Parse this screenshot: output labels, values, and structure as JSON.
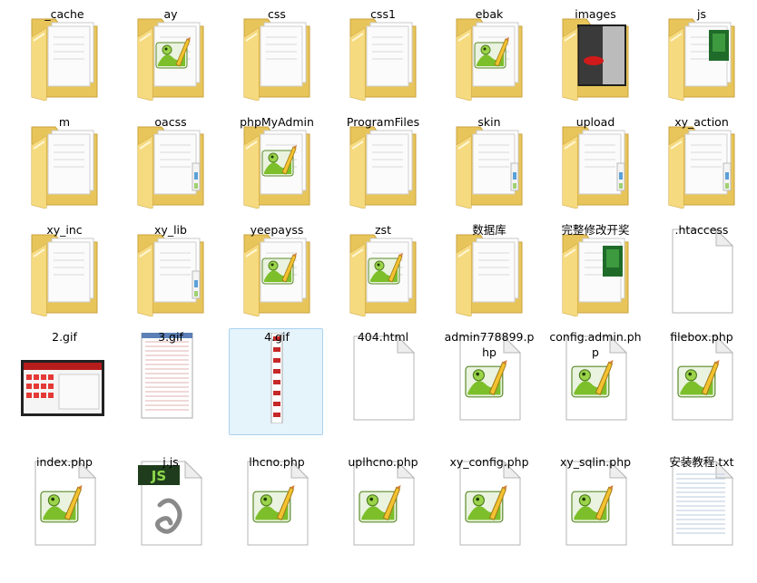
{
  "view": "file-explorer-large-icons",
  "items": [
    {
      "label": "_cache",
      "kind": "folder",
      "content": "docs"
    },
    {
      "label": "ay",
      "kind": "folder",
      "content": "notepad"
    },
    {
      "label": "css",
      "kind": "folder",
      "content": "docs"
    },
    {
      "label": "css1",
      "kind": "folder",
      "content": "docs"
    },
    {
      "label": "ebak",
      "kind": "folder",
      "content": "notepad"
    },
    {
      "label": "images",
      "kind": "folder",
      "content": "photo"
    },
    {
      "label": "js",
      "kind": "folder",
      "content": "green"
    },
    {
      "label": "m",
      "kind": "folder",
      "content": "docs"
    },
    {
      "label": "oacss",
      "kind": "folder",
      "content": "tabs"
    },
    {
      "label": "phpMyAdmin",
      "kind": "folder",
      "content": "notepad"
    },
    {
      "label": "ProgramFiles",
      "kind": "folder",
      "content": "docs"
    },
    {
      "label": "skin",
      "kind": "folder",
      "content": "tabs"
    },
    {
      "label": "upload",
      "kind": "folder",
      "content": "tabs"
    },
    {
      "label": "xy_action",
      "kind": "folder",
      "content": "tabs"
    },
    {
      "label": "xy_inc",
      "kind": "folder",
      "content": "docs"
    },
    {
      "label": "xy_lib",
      "kind": "folder",
      "content": "tabs"
    },
    {
      "label": "yeepayss",
      "kind": "folder",
      "content": "notepad"
    },
    {
      "label": "zst",
      "kind": "folder",
      "content": "notepad"
    },
    {
      "label": "数据库",
      "kind": "folder",
      "content": "blank"
    },
    {
      "label": "完整修改开奖",
      "kind": "folder",
      "content": "green"
    },
    {
      "label": ".htaccess",
      "kind": "file",
      "content": "blank"
    },
    {
      "label": "2.gif",
      "kind": "image",
      "content": "screenshot-wide"
    },
    {
      "label": "3.gif",
      "kind": "image",
      "content": "screenshot-tall"
    },
    {
      "label": "4.gif",
      "kind": "image",
      "content": "screenshot-strip"
    },
    {
      "label": "404.html",
      "kind": "file",
      "content": "blank"
    },
    {
      "label": "admin778899.php",
      "kind": "file",
      "content": "notepad"
    },
    {
      "label": "config.admin.php",
      "kind": "file",
      "content": "notepad"
    },
    {
      "label": "filebox.php",
      "kind": "file",
      "content": "notepad"
    },
    {
      "label": "index.php",
      "kind": "file",
      "content": "notepad"
    },
    {
      "label": "j.js",
      "kind": "file",
      "content": "js"
    },
    {
      "label": "lhcno.php",
      "kind": "file",
      "content": "notepad"
    },
    {
      "label": "uplhcno.php",
      "kind": "file",
      "content": "notepad"
    },
    {
      "label": "xy_config.php",
      "kind": "file",
      "content": "notepad"
    },
    {
      "label": "xy_sqlin.php",
      "kind": "file",
      "content": "notepad"
    },
    {
      "label": "安装教程.txt",
      "kind": "file",
      "content": "text"
    }
  ],
  "selected_label": "4.gif",
  "js_badge": "JS",
  "colors": {
    "folder_back": "#e8c55a",
    "folder_front": "#f8e197",
    "selection_fill": "#e5f3fb",
    "selection_border": "#a9d2f0",
    "notepad_green": "#7cbf2a"
  }
}
